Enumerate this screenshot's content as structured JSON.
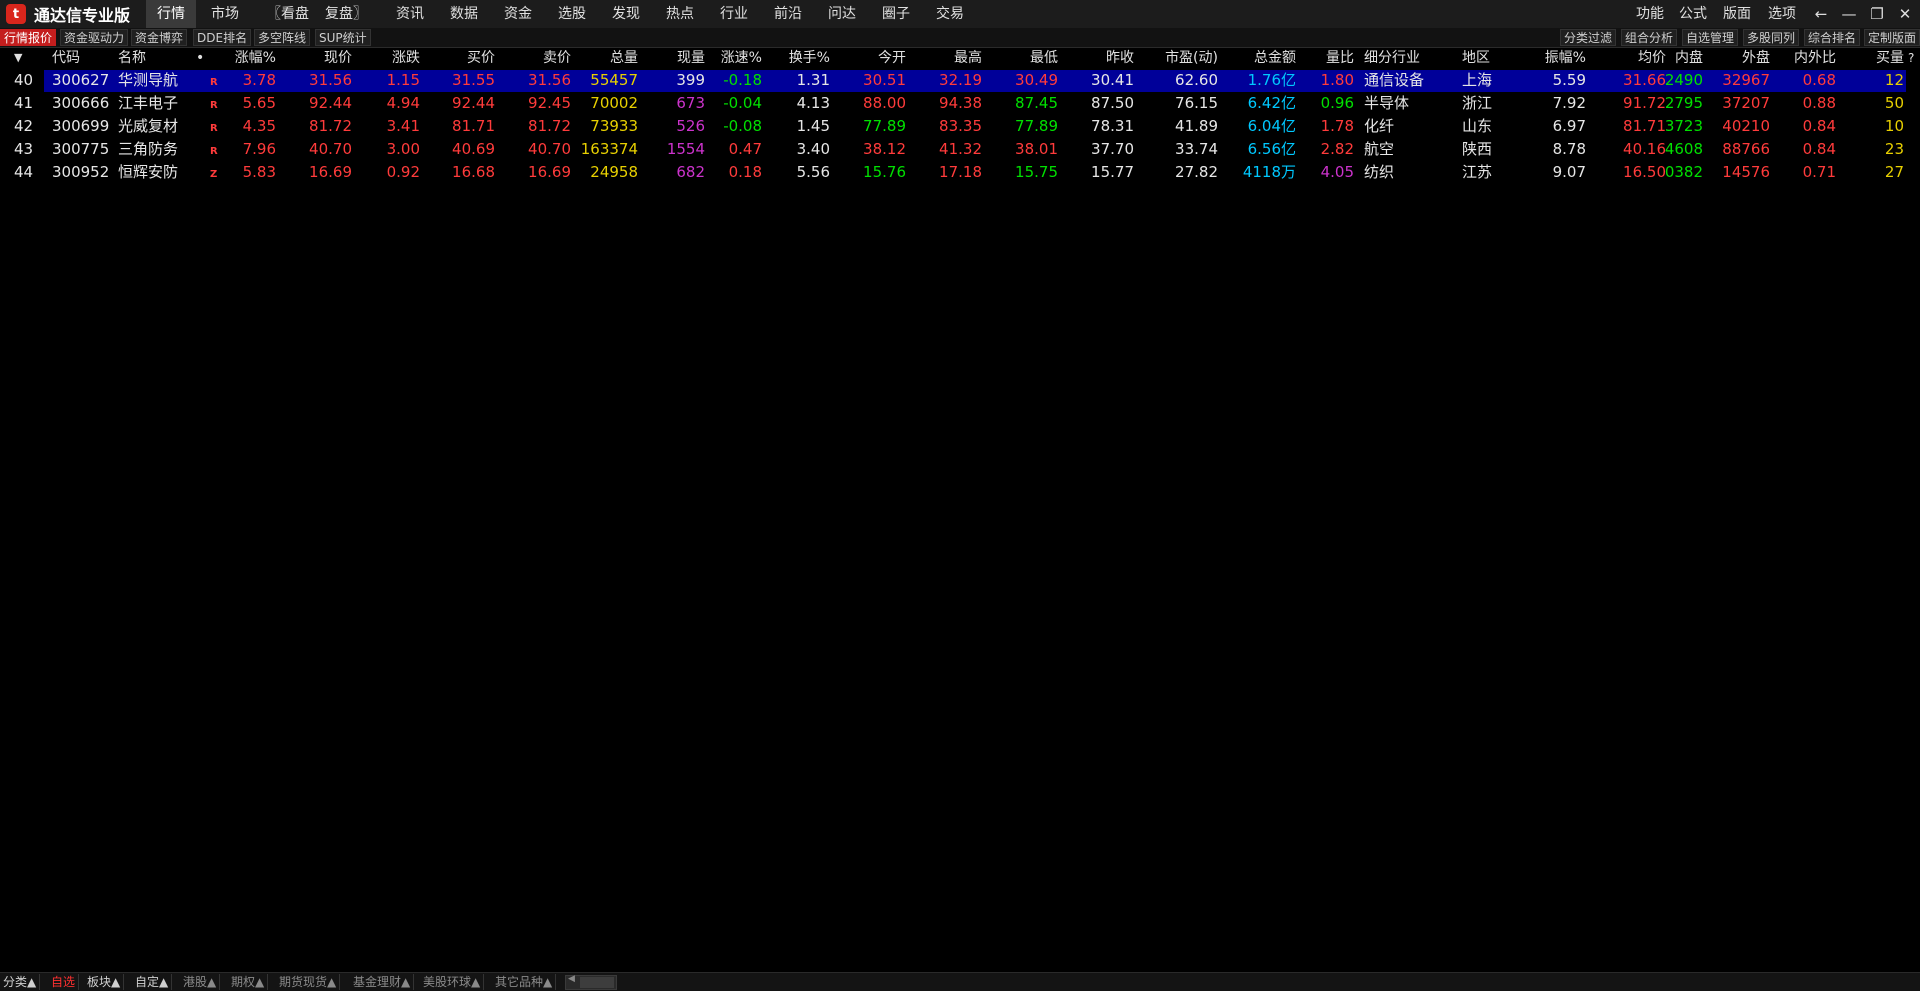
{
  "app": {
    "title": "通达信专业版",
    "logo_icon": "tdx-logo-icon"
  },
  "menu": [
    {
      "label": "行情",
      "active": true
    },
    {
      "label": "市场"
    },
    {
      "label": "〖看盘"
    },
    {
      "label": "复盘〗"
    },
    {
      "label": "资讯"
    },
    {
      "label": "数据"
    },
    {
      "label": "资金"
    },
    {
      "label": "选股"
    },
    {
      "label": "发现"
    },
    {
      "label": "热点"
    },
    {
      "label": "行业"
    },
    {
      "label": "前沿"
    },
    {
      "label": "问达"
    },
    {
      "label": "圈子"
    },
    {
      "label": "交易"
    }
  ],
  "menu_right": [
    "功能",
    "公式",
    "版面",
    "选项"
  ],
  "window_controls": {
    "back": "←",
    "minimize": "—",
    "restore": "❐",
    "close": "✕"
  },
  "toolbar_left": [
    "行情报价",
    "资金驱动力",
    "资金博弈",
    "DDE排名",
    "多空阵线",
    "SUP统计"
  ],
  "toolbar_right": [
    "分类过滤",
    "组合分析",
    "自选管理",
    "多股同列",
    "综合排名",
    "定制版面"
  ],
  "columns": [
    "",
    "代码",
    "名称",
    "•",
    "涨幅%",
    "现价",
    "涨跌",
    "买价",
    "卖价",
    "总量",
    "现量",
    "涨速%",
    "换手%",
    "今开",
    "最高",
    "最低",
    "昨收",
    "市盈(动)",
    "总金额",
    "量比",
    "细分行业",
    "地区",
    "振幅%",
    "均价",
    "内盘",
    "外盘",
    "内外比",
    "买量",
    "?"
  ],
  "sort_icon": "triangle-down-icon",
  "rows": [
    {
      "idx": "40",
      "code": "300627",
      "name": "华测导航",
      "flag": "R",
      "chg_pct": "3.78",
      "price": "31.56",
      "chg": "1.15",
      "bid": "31.55",
      "ask": "31.56",
      "vol": "55457",
      "cur_vol": "399",
      "speed": "-0.18",
      "turnover": "1.31",
      "open": "30.51",
      "high": "32.19",
      "low": "30.49",
      "prev": "30.41",
      "pe": "62.60",
      "amount": "1.76亿",
      "vol_ratio": "1.80",
      "industry": "通信设备",
      "region": "上海",
      "amplitude": "5.59",
      "avg": "31.66",
      "inner": "2490",
      "outer": "32967",
      "io_ratio": "0.68",
      "bid_vol": "12"
    },
    {
      "idx": "41",
      "code": "300666",
      "name": "江丰电子",
      "flag": "R",
      "chg_pct": "5.65",
      "price": "92.44",
      "chg": "4.94",
      "bid": "92.44",
      "ask": "92.45",
      "vol": "70002",
      "cur_vol": "673",
      "speed": "-0.04",
      "turnover": "4.13",
      "open": "88.00",
      "high": "94.38",
      "low": "87.45",
      "prev": "87.50",
      "pe": "76.15",
      "amount": "6.42亿",
      "vol_ratio": "0.96",
      "industry": "半导体",
      "region": "浙江",
      "amplitude": "7.92",
      "avg": "91.72",
      "inner": "2795",
      "outer": "37207",
      "io_ratio": "0.88",
      "bid_vol": "50"
    },
    {
      "idx": "42",
      "code": "300699",
      "name": "光威复材",
      "flag": "R",
      "chg_pct": "4.35",
      "price": "81.72",
      "chg": "3.41",
      "bid": "81.71",
      "ask": "81.72",
      "vol": "73933",
      "cur_vol": "526",
      "speed": "-0.08",
      "turnover": "1.45",
      "open": "77.89",
      "high": "83.35",
      "low": "77.89",
      "prev": "78.31",
      "pe": "41.89",
      "amount": "6.04亿",
      "vol_ratio": "1.78",
      "industry": "化纤",
      "region": "山东",
      "amplitude": "6.97",
      "avg": "81.71",
      "inner": "3723",
      "outer": "40210",
      "io_ratio": "0.84",
      "bid_vol": "10"
    },
    {
      "idx": "43",
      "code": "300775",
      "name": "三角防务",
      "flag": "R",
      "chg_pct": "7.96",
      "price": "40.70",
      "chg": "3.00",
      "bid": "40.69",
      "ask": "40.70",
      "vol": "163374",
      "cur_vol": "1554",
      "speed": "0.47",
      "turnover": "3.40",
      "open": "38.12",
      "high": "41.32",
      "low": "38.01",
      "prev": "37.70",
      "pe": "33.74",
      "amount": "6.56亿",
      "vol_ratio": "2.82",
      "industry": "航空",
      "region": "陕西",
      "amplitude": "8.78",
      "avg": "40.16",
      "inner": "4608",
      "outer": "88766",
      "io_ratio": "0.84",
      "bid_vol": "23"
    },
    {
      "idx": "44",
      "code": "300952",
      "name": "恒辉安防",
      "flag": "Z",
      "chg_pct": "5.83",
      "price": "16.69",
      "chg": "0.92",
      "bid": "16.68",
      "ask": "16.69",
      "vol": "24958",
      "cur_vol": "682",
      "speed": "0.18",
      "turnover": "5.56",
      "open": "15.76",
      "high": "17.18",
      "low": "15.75",
      "prev": "15.77",
      "pe": "27.82",
      "amount": "4118万",
      "vol_ratio": "4.05",
      "industry": "纺织",
      "region": "江苏",
      "amplitude": "9.07",
      "avg": "16.50",
      "inner": "0382",
      "outer": "14576",
      "io_ratio": "0.71",
      "bid_vol": "27"
    }
  ],
  "bottom_tabs": [
    {
      "label": "分类▲"
    },
    {
      "label": "自选",
      "active": true
    },
    {
      "label": "板块▲"
    },
    {
      "label": "自定▲"
    },
    {
      "label": "港股▲",
      "dim": true
    },
    {
      "label": "期权▲",
      "dim": true
    },
    {
      "label": "期货现货▲",
      "dim": true
    },
    {
      "label": "基金理财▲",
      "dim": true
    },
    {
      "label": "美股环球▲",
      "dim": true
    },
    {
      "label": "其它品种▲",
      "dim": true
    }
  ],
  "colors": {
    "up": "#ff3b3b",
    "down": "#00e000",
    "selected_row": "#000099",
    "volume": "#e8d000",
    "amount": "#00c8ff",
    "cur_vol": "#cc33cc"
  }
}
